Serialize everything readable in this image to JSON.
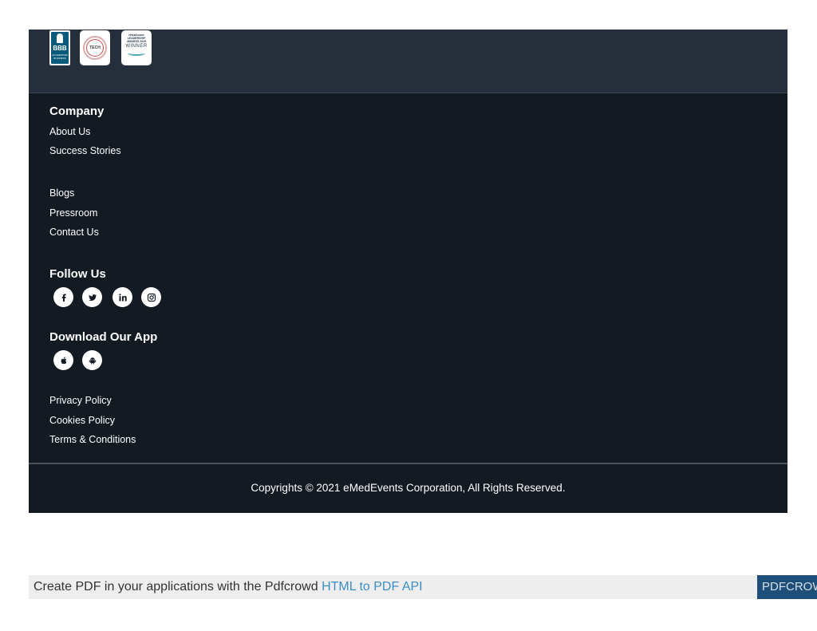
{
  "badges": {
    "bbb_label": "BBB",
    "bbb_sub": "ACCREDITED BUSINESS",
    "tech_label": "TECH",
    "award_line1": "eHealthcare",
    "award_line2": "LEADERSHIP",
    "award_line3": "AWARDS 2020",
    "award_winner": "WINNER"
  },
  "company": {
    "heading": "Company",
    "links": [
      "About Us",
      "Success Stories",
      "Blogs",
      "Pressroom",
      "Contact Us"
    ]
  },
  "follow": {
    "heading": "Follow Us",
    "icons": [
      "facebook-icon",
      "twitter-icon",
      "linkedin-icon",
      "instagram-icon"
    ]
  },
  "app": {
    "heading": "Download Our App",
    "icons": [
      "apple-icon",
      "android-icon"
    ]
  },
  "legal": {
    "links": [
      "Privacy Policy",
      "Cookies Policy",
      "Terms & Conditions"
    ]
  },
  "copyright": "Copyrights © 2021 eMedEvents Corporation, All Rights Reserved.",
  "pdf_bar": {
    "prefix": "Create PDF in your applications with the Pdfcrowd ",
    "link": "HTML to PDF API",
    "brand": "PDFCROWD"
  },
  "colors": {
    "badge_band": "#242f3b",
    "main_band": "#131a22",
    "icon_bg": "#ffffff",
    "icon_fg": "#131a22",
    "pdf_link": "#3b8ec8",
    "pdf_brand_bg": "#1f4e78"
  }
}
